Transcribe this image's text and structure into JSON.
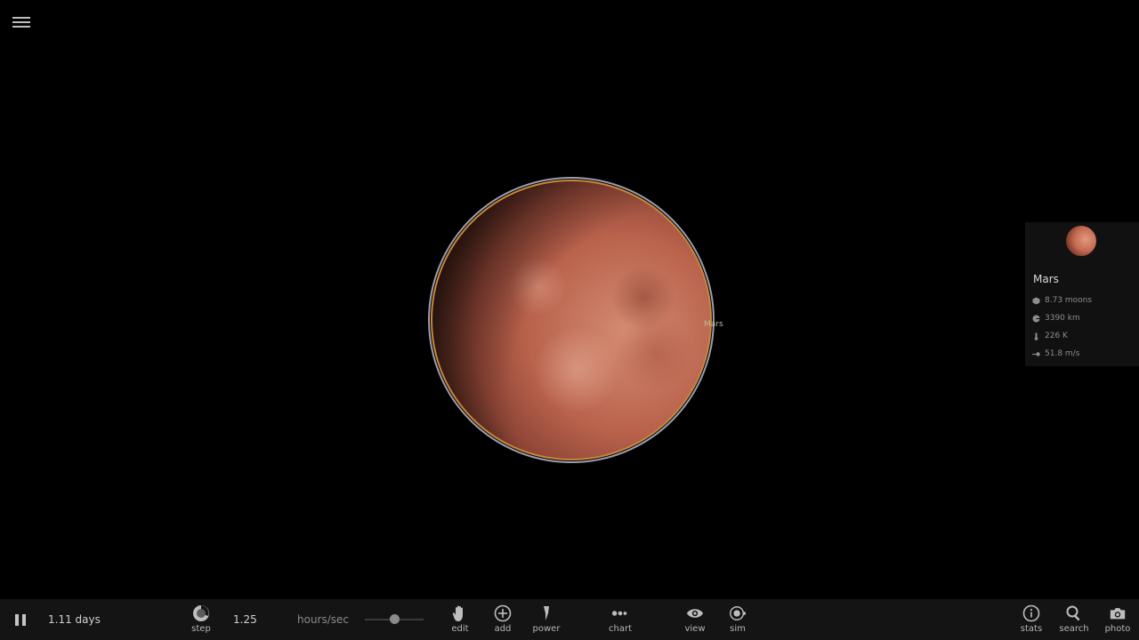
{
  "app": {
    "menu_icon": "hamburger-menu-icon"
  },
  "planet": {
    "name_label": "Mars"
  },
  "info_panel": {
    "name": "Mars",
    "rows": [
      {
        "icon": "mass-icon",
        "value": "8.73 moons"
      },
      {
        "icon": "radius-icon",
        "value": "3390 km"
      },
      {
        "icon": "temperature-icon",
        "value": "226 K"
      },
      {
        "icon": "velocity-icon",
        "value": "51.8 m/s"
      }
    ]
  },
  "bottom_bar": {
    "pause_icon": "pause-icon",
    "elapsed_time": "1.11 days",
    "step_label": "step",
    "speed_value": "1.25",
    "speed_unit": "hours/sec",
    "speed_fraction": 0.5,
    "tools": {
      "edit": "edit",
      "add": "add",
      "power": "power",
      "chart": "chart",
      "view": "view",
      "sim": "sim",
      "stats": "stats",
      "search": "search",
      "photo": "photo"
    }
  },
  "colors": {
    "background": "#000000",
    "bar": "#141414",
    "planet_rim": "#c8873a"
  }
}
